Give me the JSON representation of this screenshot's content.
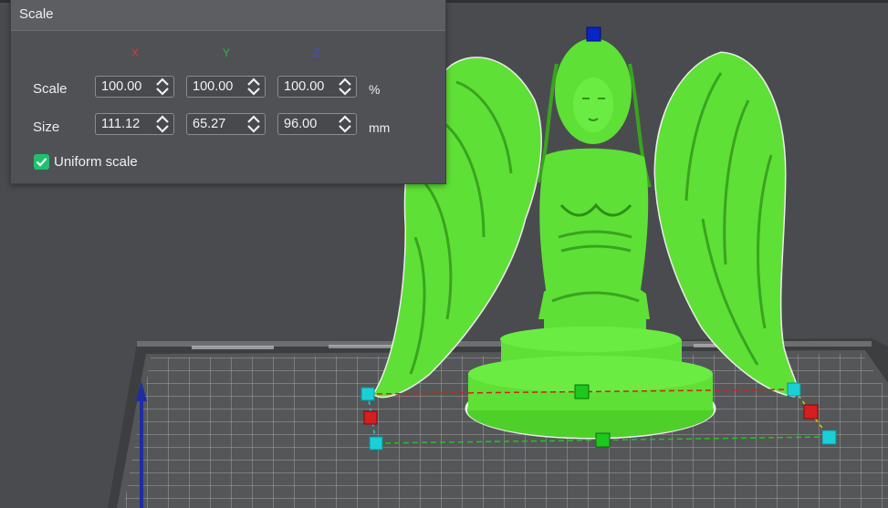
{
  "panel": {
    "title": "Scale",
    "axes": [
      {
        "label": "X",
        "color": "#d43b3b"
      },
      {
        "label": "Y",
        "color": "#2fb84b"
      },
      {
        "label": "Z",
        "color": "#3a4fe0"
      }
    ],
    "scale_row": {
      "label": "Scale",
      "values": [
        "100.00",
        "100.00",
        "100.00"
      ],
      "unit": "%"
    },
    "size_row": {
      "label": "Size",
      "values": [
        "111.12",
        "65.27",
        "96.00"
      ],
      "unit": "mm"
    },
    "uniform_scale": {
      "label": "Uniform scale",
      "checked": true
    }
  },
  "colors": {
    "model": "#5ee036",
    "handle_corner": "#1ccfd6",
    "handle_x": "#d61e1e",
    "handle_y": "#1bc81b",
    "handle_z": "#0a24c8",
    "bed_grid": "#b7b7b7",
    "axis_z_arrow": "#1d2fa0"
  },
  "icons": [
    "spin-arrows-icon",
    "checkmark-icon",
    "z-axis-arrow-icon"
  ]
}
